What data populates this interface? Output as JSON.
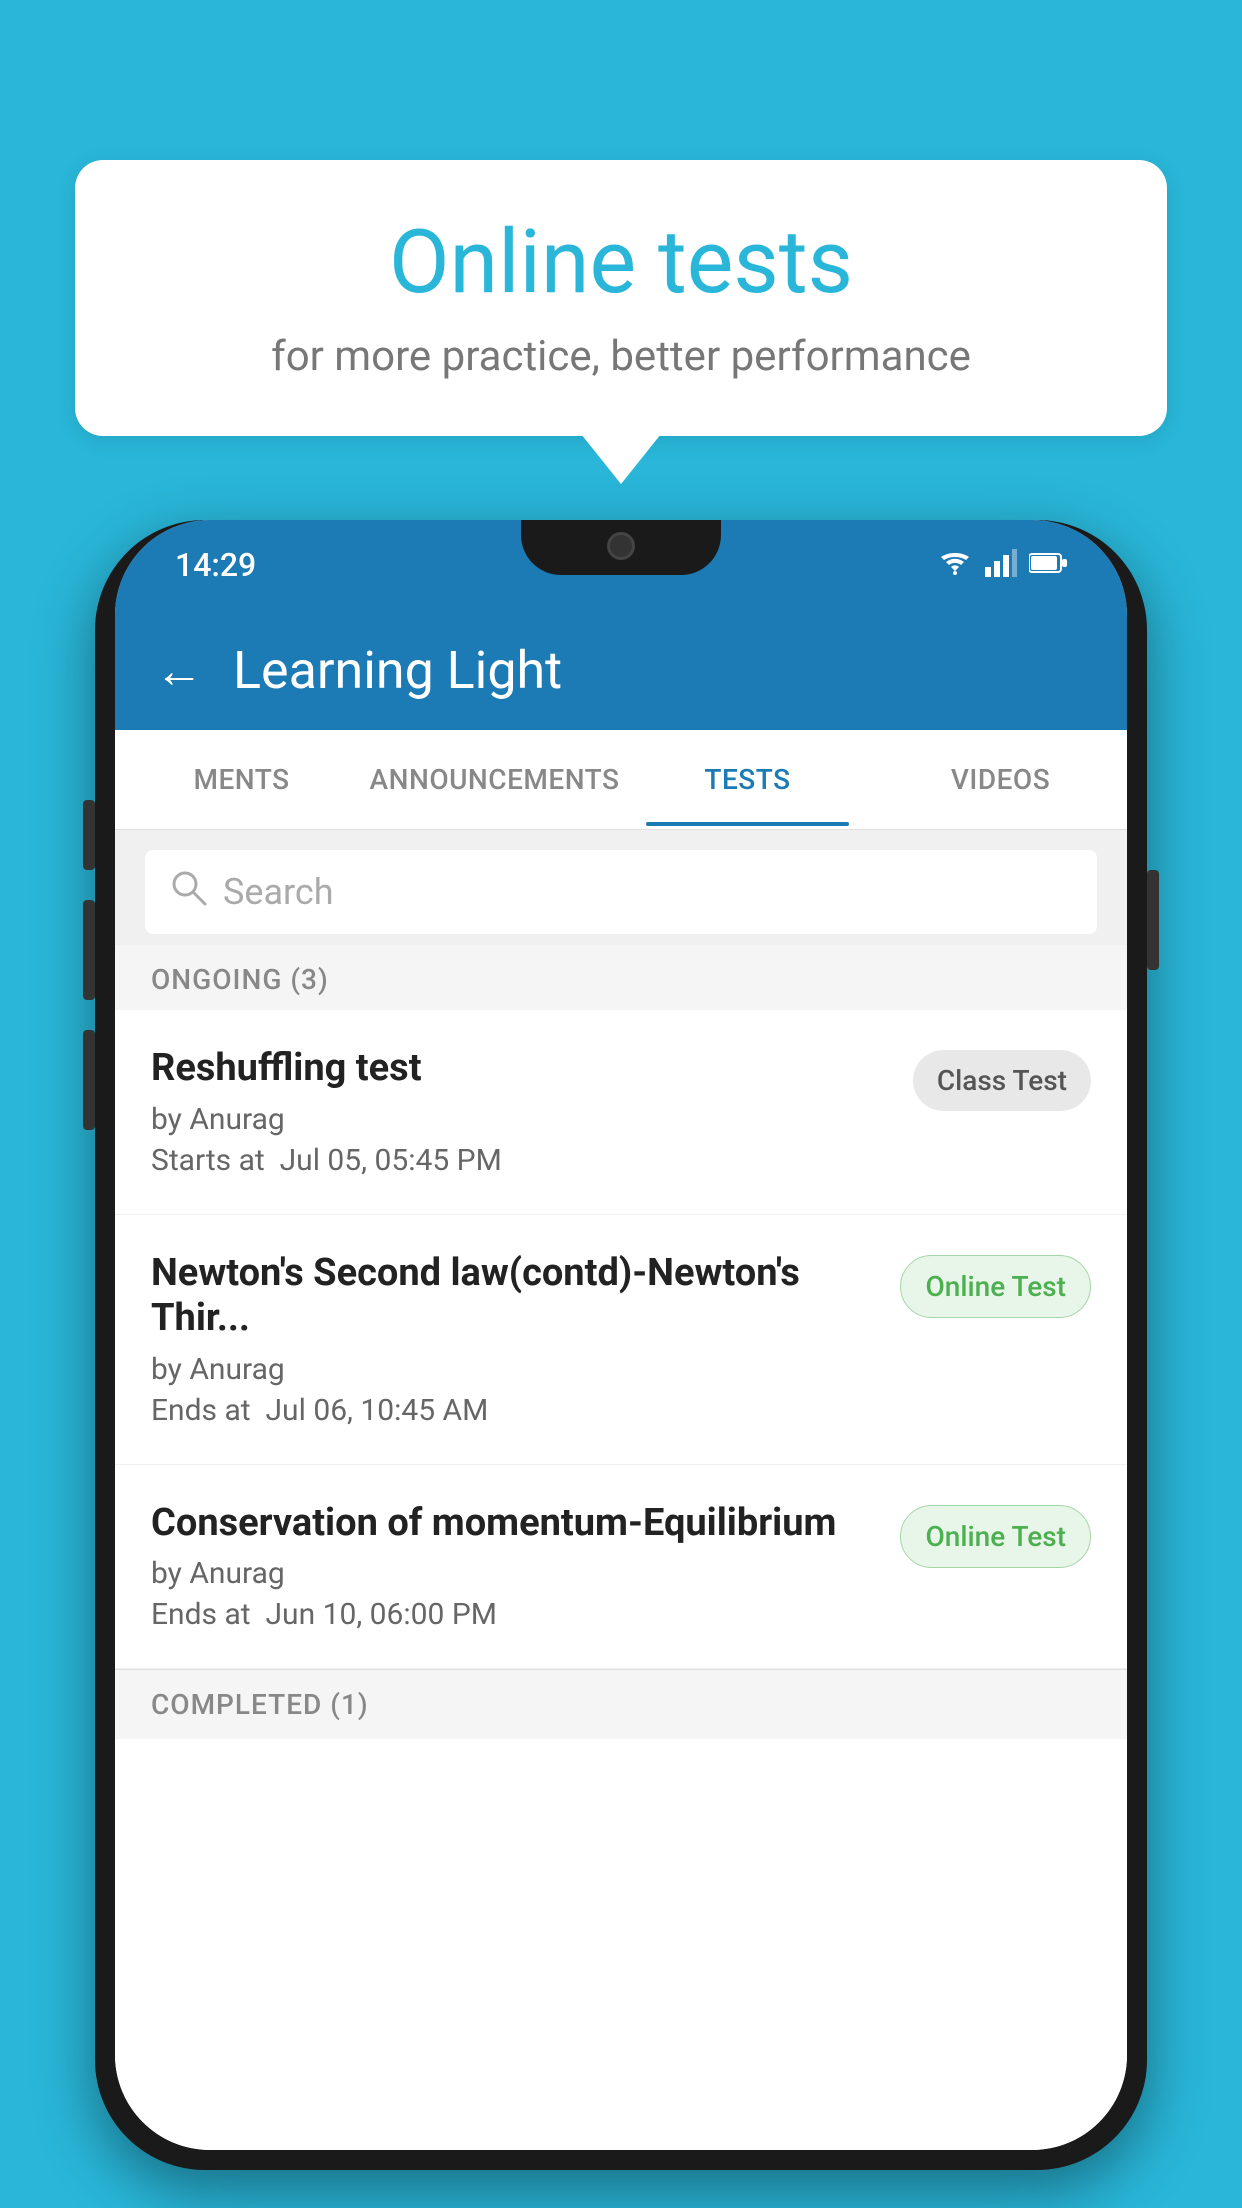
{
  "background_color": "#29b6d8",
  "bubble": {
    "title": "Online tests",
    "subtitle": "for more practice, better performance"
  },
  "phone": {
    "status_bar": {
      "time": "14:29",
      "wifi": "▼",
      "signal": "▲",
      "battery": "▮"
    },
    "app_bar": {
      "back_label": "←",
      "title": "Learning Light"
    },
    "tabs": [
      {
        "label": "MENTS",
        "active": false
      },
      {
        "label": "ANNOUNCEMENTS",
        "active": false
      },
      {
        "label": "TESTS",
        "active": true
      },
      {
        "label": "VIDEOS",
        "active": false
      }
    ],
    "search": {
      "placeholder": "Search"
    },
    "section_ongoing": {
      "label": "ONGOING (3)"
    },
    "tests": [
      {
        "name": "Reshuffling test",
        "author": "by Anurag",
        "time_label": "Starts at",
        "time": "Jul 05, 05:45 PM",
        "badge": "Class Test",
        "badge_type": "class"
      },
      {
        "name": "Newton's Second law(contd)-Newton's Thir...",
        "author": "by Anurag",
        "time_label": "Ends at",
        "time": "Jul 06, 10:45 AM",
        "badge": "Online Test",
        "badge_type": "online"
      },
      {
        "name": "Conservation of momentum-Equilibrium",
        "author": "by Anurag",
        "time_label": "Ends at",
        "time": "Jun 10, 06:00 PM",
        "badge": "Online Test",
        "badge_type": "online"
      }
    ],
    "section_completed": {
      "label": "COMPLETED (1)"
    }
  }
}
